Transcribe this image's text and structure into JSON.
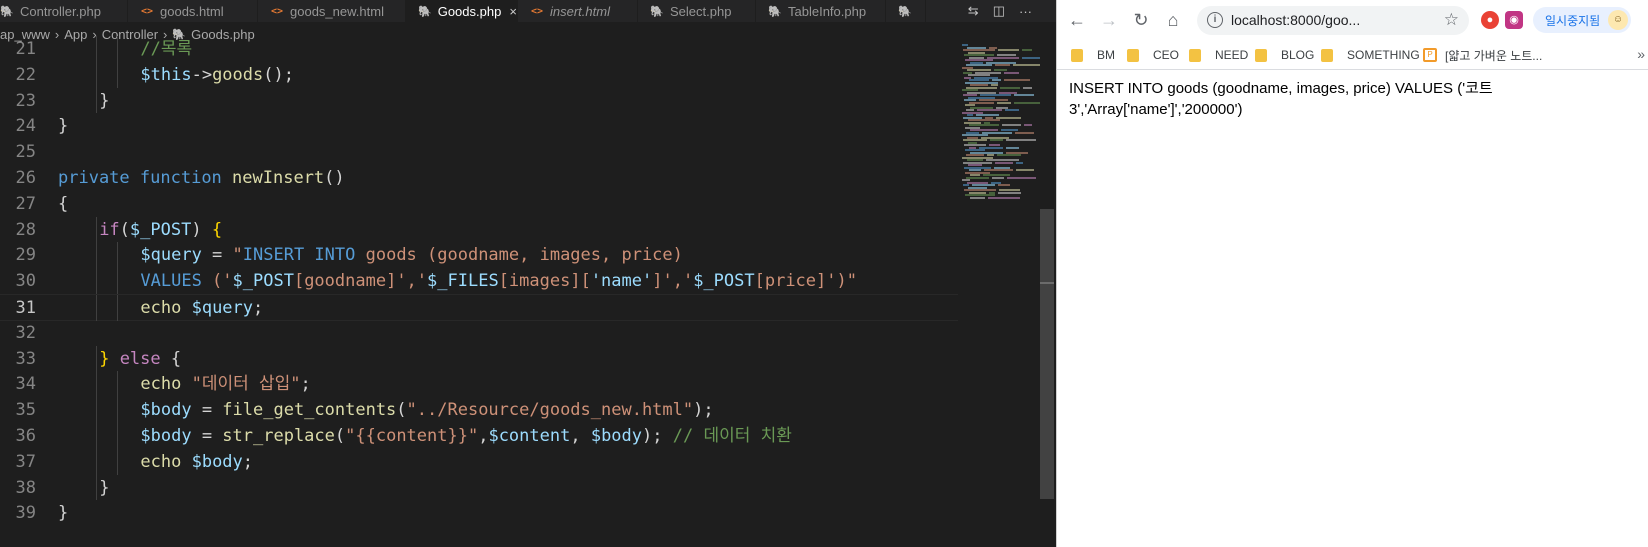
{
  "editor": {
    "tabs": [
      {
        "label": "Controller.php",
        "type": "php",
        "active": false,
        "italic": false
      },
      {
        "label": "goods.html",
        "type": "html",
        "active": false,
        "italic": false
      },
      {
        "label": "goods_new.html",
        "type": "html",
        "active": false,
        "italic": false
      },
      {
        "label": "Goods.php",
        "type": "php",
        "active": true,
        "italic": false
      },
      {
        "label": "insert.html",
        "type": "html",
        "active": false,
        "italic": true
      },
      {
        "label": "Select.php",
        "type": "php",
        "active": false,
        "italic": false
      },
      {
        "label": "TableInfo.php",
        "type": "php",
        "active": false,
        "italic": false
      },
      {
        "label": "",
        "type": "php",
        "active": false,
        "italic": false
      }
    ],
    "tab_close_glyph": "×",
    "tab_actions": [
      "compare-icon",
      "split-editor-icon",
      "more-actions-icon"
    ],
    "tab_actions_glyphs": [
      "⇆",
      "◫",
      "···"
    ],
    "breadcrumb": [
      "ap_www",
      "App",
      "Controller",
      "Goods.php"
    ],
    "current_line": 31,
    "lines": [
      {
        "n": 21,
        "indent": 6,
        "tokens": [
          {
            "t": "//",
            "c": "cmt"
          },
          {
            "t": "목록",
            "c": "cmt"
          }
        ]
      },
      {
        "n": 22,
        "indent": 6,
        "tokens": [
          {
            "t": "$this",
            "c": "var"
          },
          {
            "t": "->",
            "c": "plain"
          },
          {
            "t": "goods",
            "c": "fn"
          },
          {
            "t": "();",
            "c": "plain"
          }
        ]
      },
      {
        "n": 23,
        "indent": 4,
        "tokens": [
          {
            "t": "}",
            "c": "plain"
          }
        ]
      },
      {
        "n": 24,
        "indent": 2,
        "tokens": [
          {
            "t": "}",
            "c": "plain"
          }
        ]
      },
      {
        "n": 25,
        "indent": 0,
        "tokens": []
      },
      {
        "n": 26,
        "indent": 2,
        "tokens": [
          {
            "t": "private",
            "c": "kw"
          },
          {
            "t": " ",
            "c": "plain"
          },
          {
            "t": "function",
            "c": "kw"
          },
          {
            "t": " ",
            "c": "plain"
          },
          {
            "t": "newInsert",
            "c": "fn"
          },
          {
            "t": "()",
            "c": "plain"
          }
        ]
      },
      {
        "n": 27,
        "indent": 2,
        "tokens": [
          {
            "t": "{",
            "c": "plain"
          }
        ]
      },
      {
        "n": 28,
        "indent": 4,
        "tokens": [
          {
            "t": "if",
            "c": "ctrl"
          },
          {
            "t": "(",
            "c": "plain"
          },
          {
            "t": "$_POST",
            "c": "var"
          },
          {
            "t": ") ",
            "c": "plain"
          },
          {
            "t": "{",
            "c": "brace"
          }
        ]
      },
      {
        "n": 29,
        "indent": 6,
        "tokens": [
          {
            "t": "$query",
            "c": "var"
          },
          {
            "t": " = ",
            "c": "plain"
          },
          {
            "t": "\"",
            "c": "str"
          },
          {
            "t": "INSERT INTO",
            "c": "kw"
          },
          {
            "t": " goods (goodname, images, price)",
            "c": "str"
          }
        ]
      },
      {
        "n": 30,
        "indent": 6,
        "tokens": [
          {
            "t": "VALUES",
            "c": "kw"
          },
          {
            "t": " ('",
            "c": "str"
          },
          {
            "t": "$_POST",
            "c": "var"
          },
          {
            "t": "[goodname]",
            "c": "str"
          },
          {
            "t": "','",
            "c": "str"
          },
          {
            "t": "$_FILES",
            "c": "var"
          },
          {
            "t": "[images][",
            "c": "str"
          },
          {
            "t": "'name'",
            "c": "var"
          },
          {
            "t": "]','",
            "c": "str"
          },
          {
            "t": "$_POST",
            "c": "var"
          },
          {
            "t": "[price]",
            "c": "str"
          },
          {
            "t": "')\"",
            "c": "str"
          }
        ]
      },
      {
        "n": 31,
        "indent": 6,
        "tokens": [
          {
            "t": "echo",
            "c": "fn"
          },
          {
            "t": " ",
            "c": "plain"
          },
          {
            "t": "$query",
            "c": "var"
          },
          {
            "t": ";",
            "c": "plain"
          }
        ]
      },
      {
        "n": 32,
        "indent": 0,
        "tokens": []
      },
      {
        "n": 33,
        "indent": 4,
        "tokens": [
          {
            "t": "}",
            "c": "brace"
          },
          {
            "t": " ",
            "c": "plain"
          },
          {
            "t": "else",
            "c": "ctrl"
          },
          {
            "t": " {",
            "c": "plain"
          }
        ]
      },
      {
        "n": 34,
        "indent": 6,
        "tokens": [
          {
            "t": "echo",
            "c": "fn"
          },
          {
            "t": " ",
            "c": "plain"
          },
          {
            "t": "\"데이터 삽입\"",
            "c": "str"
          },
          {
            "t": ";",
            "c": "plain"
          }
        ]
      },
      {
        "n": 35,
        "indent": 6,
        "tokens": [
          {
            "t": "$body",
            "c": "var"
          },
          {
            "t": " = ",
            "c": "plain"
          },
          {
            "t": "file_get_contents",
            "c": "fn"
          },
          {
            "t": "(",
            "c": "plain"
          },
          {
            "t": "\"../Resource/goods_new.html\"",
            "c": "str"
          },
          {
            "t": ");",
            "c": "plain"
          }
        ]
      },
      {
        "n": 36,
        "indent": 6,
        "tokens": [
          {
            "t": "$body",
            "c": "var"
          },
          {
            "t": " = ",
            "c": "plain"
          },
          {
            "t": "str_replace",
            "c": "fn"
          },
          {
            "t": "(",
            "c": "plain"
          },
          {
            "t": "\"{{content}}\"",
            "c": "str"
          },
          {
            "t": ",",
            "c": "plain"
          },
          {
            "t": "$content",
            "c": "var"
          },
          {
            "t": ", ",
            "c": "plain"
          },
          {
            "t": "$body",
            "c": "var"
          },
          {
            "t": "); ",
            "c": "plain"
          },
          {
            "t": "// 데이터 치환",
            "c": "cmt"
          }
        ]
      },
      {
        "n": 37,
        "indent": 6,
        "tokens": [
          {
            "t": "echo",
            "c": "fn"
          },
          {
            "t": " ",
            "c": "plain"
          },
          {
            "t": "$body",
            "c": "var"
          },
          {
            "t": ";",
            "c": "plain"
          }
        ]
      },
      {
        "n": 38,
        "indent": 4,
        "tokens": [
          {
            "t": "}",
            "c": "plain"
          }
        ]
      },
      {
        "n": 39,
        "indent": 2,
        "tokens": [
          {
            "t": "}",
            "c": "plain"
          }
        ]
      }
    ]
  },
  "browser": {
    "url": "localhost:8000/goo...",
    "profile_label": "일시중지됨",
    "nav_glyphs": {
      "back": "←",
      "forward": "→",
      "reload": "↻",
      "home": "⌂",
      "star": "☆",
      "info": "i",
      "more": "»"
    },
    "bookmarks": [
      {
        "label": "BM",
        "icon": "folder"
      },
      {
        "label": "CEO",
        "icon": "folder"
      },
      {
        "label": "NEED",
        "icon": "folder"
      },
      {
        "label": "BLOG",
        "icon": "folder"
      },
      {
        "label": "SOMETHING",
        "icon": "folder"
      },
      {
        "label": "[얇고 가벼운 노트...",
        "icon": "page"
      }
    ],
    "page_text": "INSERT INTO goods (goodname, images, price) VALUES ('코트 3','Array['name']','200000')"
  },
  "colors": {
    "editor_bg": "#1e1e1e",
    "tabbar_bg": "#252526",
    "keyword": "#569cd6",
    "control": "#c586c0",
    "function": "#dcdcaa",
    "variable": "#9cdcfe",
    "string": "#ce9178",
    "comment": "#6a9955"
  }
}
